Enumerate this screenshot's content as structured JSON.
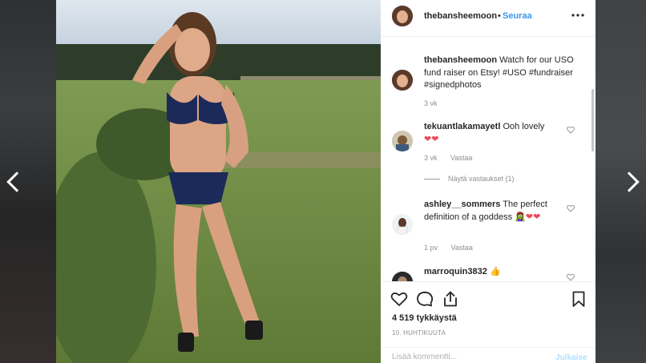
{
  "post": {
    "username": "thebansheemoon",
    "follow_label": "Seuraa",
    "dot": "•",
    "more_icon": "more-horizontal-icon"
  },
  "comments": [
    {
      "username": "thebansheemoon",
      "text": "Watch for our USO fund raiser on Etsy! #USO #fundraiser #signedphotos",
      "time": "3 vk",
      "reply_label": ""
    },
    {
      "username": "tekuantlakamayetl",
      "text": "Ooh lovely",
      "emoji": "❤❤",
      "time": "3 vk",
      "reply_label": "Vastaa",
      "view_replies": "Näytä vastaukset (1)"
    },
    {
      "username": "ashley__sommers",
      "text": "The perfect definition of a goddess",
      "emoji": "🧟‍♀️❤❤",
      "time": "1 pv",
      "reply_label": "Vastaa"
    },
    {
      "username": "marroquin3832",
      "text": "👍",
      "time": "",
      "reply_label": ""
    }
  ],
  "actions": {
    "like_icon": "heart-icon",
    "comment_icon": "comment-icon",
    "share_icon": "share-icon",
    "save_icon": "bookmark-icon"
  },
  "likes": "4 519 tykkäystä",
  "date": "10. HUHTIKUUTA",
  "add_comment": {
    "placeholder": "Lisää kommentti...",
    "post_label": "Julkaise"
  },
  "colors": {
    "accent": "#3897f0",
    "heart": "#ed4956",
    "muted": "#8e8e8e"
  }
}
